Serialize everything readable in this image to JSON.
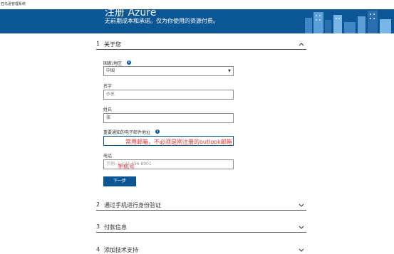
{
  "window": {
    "title": "亚马逊管理系统"
  },
  "banner": {
    "title": "注册 Azure",
    "subtitle": "无前期成本和承诺。仅为你使用的资源付费。"
  },
  "sections": [
    {
      "number": "1",
      "label": "关于您",
      "expanded": true
    },
    {
      "number": "2",
      "label": "通过手机进行身份验证",
      "expanded": false
    },
    {
      "number": "3",
      "label": "付款信息",
      "expanded": false
    },
    {
      "number": "4",
      "label": "添加技术支持",
      "expanded": false
    }
  ],
  "form": {
    "country": {
      "label": "国家/地区",
      "value": "中国"
    },
    "first_name": {
      "label": "名字",
      "value": "小三"
    },
    "last_name": {
      "label": "姓氏",
      "value": "张"
    },
    "email": {
      "label": "重要通知的电子邮件地址",
      "value": ""
    },
    "phone": {
      "label": "电话",
      "placeholder": "示例: 1 123 456 8901"
    },
    "next_button": "下一步"
  },
  "annotations": {
    "email_note": "常用邮箱，不必须是刚注册的outlook邮箱",
    "phone_note": "手机号"
  },
  "colors": {
    "brand": "#0b5796",
    "annotation": "#e03030"
  }
}
